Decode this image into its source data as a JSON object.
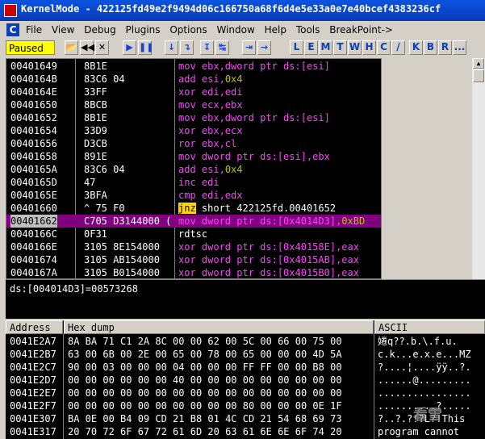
{
  "window": {
    "title": "KernelMode - 422125fd49e2f9494d06c166750a68f6d4e5e33a0e7e40bcef4383236cf"
  },
  "menu": {
    "app_icon": "C",
    "items": [
      "File",
      "View",
      "Debug",
      "Plugins",
      "Options",
      "Window",
      "Help",
      "Tools",
      "BreakPoint->"
    ]
  },
  "toolbar": {
    "status": "Paused",
    "buttons": [
      "open-icon",
      "rewind-icon",
      "close-icon",
      "run-icon",
      "pause-icon",
      "step-into-icon",
      "step-over-icon",
      "trace-into-icon",
      "trace-over-icon",
      "execute-till-return-icon",
      "goto-icon"
    ],
    "letters": [
      "L",
      "E",
      "M",
      "T",
      "W",
      "H",
      "C",
      "/",
      "K",
      "B",
      "R",
      "..."
    ]
  },
  "cpu": {
    "rows": [
      {
        "addr": "00401649",
        "hex": "8B1E",
        "mn": "mov",
        "op": "ebx,dword ptr ds:[esi]"
      },
      {
        "addr": "0040164B",
        "hex": "83C6 04",
        "mn": "add",
        "op": "esi,",
        "imm": "0x4"
      },
      {
        "addr": "0040164E",
        "hex": "33FF",
        "mn": "xor",
        "op": "edi,edi"
      },
      {
        "addr": "00401650",
        "hex": "8BCB",
        "mn": "mov",
        "op": "ecx,ebx"
      },
      {
        "addr": "00401652",
        "hex": "8B1E",
        "mn": "mov",
        "op": "ebx,dword ptr ds:[esi]"
      },
      {
        "addr": "00401654",
        "hex": "33D9",
        "mn": "xor",
        "op": "ebx,ecx"
      },
      {
        "addr": "00401656",
        "hex": "D3CB",
        "mn": "ror",
        "op": "ebx,cl"
      },
      {
        "addr": "00401658",
        "hex": "891E",
        "mn": "mov",
        "op": "dword ptr ds:[esi],ebx"
      },
      {
        "addr": "0040165A",
        "hex": "83C6 04",
        "mn": "add",
        "op": "esi,",
        "imm": "0x4"
      },
      {
        "addr": "0040165D",
        "hex": "47",
        "mn": "inc",
        "op": "edi"
      },
      {
        "addr": "0040165E",
        "hex": "3BFA",
        "mn": "cmp",
        "op": "edi,edx"
      },
      {
        "addr": "00401660",
        "hex": "^ 75 F0",
        "mn": "jnz",
        "op": "short 422125fd.00401652"
      },
      {
        "addr": "00401662",
        "hex": "C705 D3144000 (",
        "mn": "mov",
        "op": "dword ptr ds:[0x4014D3],",
        "imm": "0xBD"
      },
      {
        "addr": "0040166C",
        "hex": "0F31",
        "mn": "rdtsc",
        "op": ""
      },
      {
        "addr": "0040166E",
        "hex": "3105 8E154000",
        "mn": "xor",
        "op": "dword ptr ds:[0x40158E],eax"
      },
      {
        "addr": "00401674",
        "hex": "3105 AB154000",
        "mn": "xor",
        "op": "dword ptr ds:[0x4015AB],eax"
      },
      {
        "addr": "0040167A",
        "hex": "3105 B0154000",
        "mn": "xor",
        "op": "dword ptr ds:[0x4015B0],eax"
      }
    ]
  },
  "info": {
    "text": "ds:[004014D3]=00573268"
  },
  "dump": {
    "headers": {
      "address": "Address",
      "hex": "Hex dump",
      "ascii": "ASCII"
    },
    "rows": [
      {
        "addr": "0041E2A7",
        "hex": "8A BA 71 C1 2A 8C 00 00 62 00 5C 00 66 00 75 00",
        "ascii": "婘q??.b.\\.f.u."
      },
      {
        "addr": "0041E2B7",
        "hex": "63 00 6B 00 2E 00 65 00 78 00 65 00 00 00 4D 5A",
        "ascii": "c.k...e.x.e...MZ"
      },
      {
        "addr": "0041E2C7",
        "hex": "90 00 03 00 00 00 04 00 00 00 FF FF 00 00 B8 00",
        "ascii": "?....¦....ÿÿ..?."
      },
      {
        "addr": "0041E2D7",
        "hex": "00 00 00 00 00 00 40 00 00 00 00 00 00 00 00 00",
        "ascii": "......@........."
      },
      {
        "addr": "0041E2E7",
        "hex": "00 00 00 00 00 00 00 00 00 00 00 00 00 00 00 00",
        "ascii": "................"
      },
      {
        "addr": "0041E2F7",
        "hex": "00 00 00 00 00 00 00 00 00 00 80 00 00 00 0E 1F",
        "ascii": "..........?....."
      },
      {
        "addr": "0041E307",
        "hex": "BA 0E 00 B4 09 CD 21 B8 01 4C CD 21 54 68 69 73",
        "ascii": "?..?.?!?L?!This"
      },
      {
        "addr": "0041E317",
        "hex": "20 70 72 6F 67 72 61 6D 20 63 61 6E 6E 6F 74 20",
        "ascii": " program cannot "
      }
    ]
  },
  "watermark": "看雪"
}
